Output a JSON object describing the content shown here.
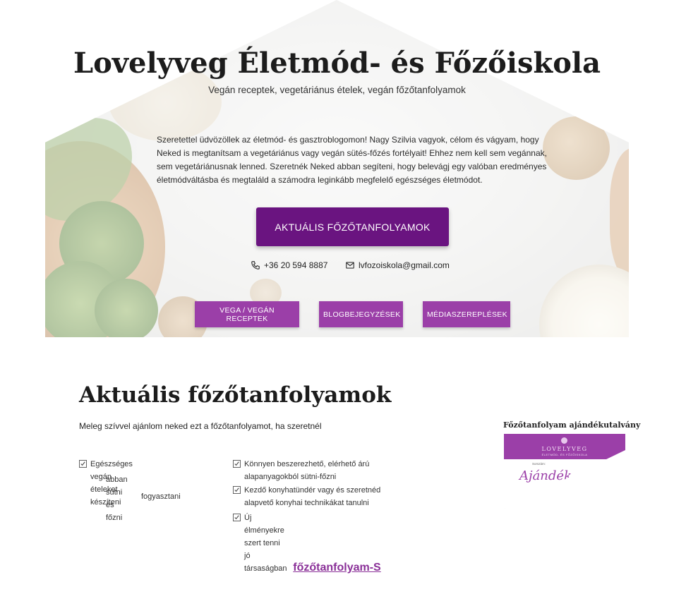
{
  "hero": {
    "title": "Lovelyveg Életmód- és Főzőiskola",
    "subtitle": "Vegán receptek, vegetáriánus ételek, vegán főzőtanfolyamok",
    "intro": "Szeretettel üdvözöllek az életmód- és gasztroblogomon! Nagy Szilvia vagyok, célom és vágyam, hogy Neked is megtanítsam a vegetáriánus vagy vegán sütés-főzés fortélyait! Ehhez nem kell sem vegánnak, sem vegetáriánusnak lenned. Szeretnék Neked abban segíteni, hogy belevágj egy valóban eredményes életmódváltásba és megtaláld a számodra leginkább megfelelő egészséges életmódot.",
    "cta_label": "AKTUÁLIS FŐZŐTANFOLYAMOK",
    "phone": "+36 20 594 8887",
    "email": "lvfozoiskola@gmail.com",
    "pills": [
      "VEGA / VEGÁN RECEPTEK",
      "BLOGBEJEGYZÉSEK",
      "MÉDIASZEREPLÉSEK"
    ]
  },
  "courses": {
    "title": "Aktuális főzőtanfolyamok",
    "lead": "Meleg szívvel ajánlom neked ezt a főzőtanfolyamot, ha szeretnél",
    "checks_left": [
      "Egészséges vegán ételeket készíteni",
      "abban sütni és főzni",
      "fogyasztani"
    ],
    "checks_right": [
      "Könnyen beszerezhető, elérhető árú alapanyagokból sütni-főzni",
      "Kezdő konyhatündér vagy és szeretnéd alapvető konyhai technikákat tanulni",
      "Új élményekre szert tenni jó társaságban"
    ],
    "voucher_title": "Főzőtanfolyam ajándékutalvány",
    "voucher_logo": "LOVELYVEG",
    "voucher_tag": "ÉLETMÓD- ÉS FŐZŐISKOLA",
    "voucher_line": "Sorszám:",
    "voucher_script": "Ajándék",
    "bottom_link": "főzőtanfolyam-S"
  },
  "colors": {
    "primary": "#6a1480",
    "accent": "#9b3fa8"
  }
}
